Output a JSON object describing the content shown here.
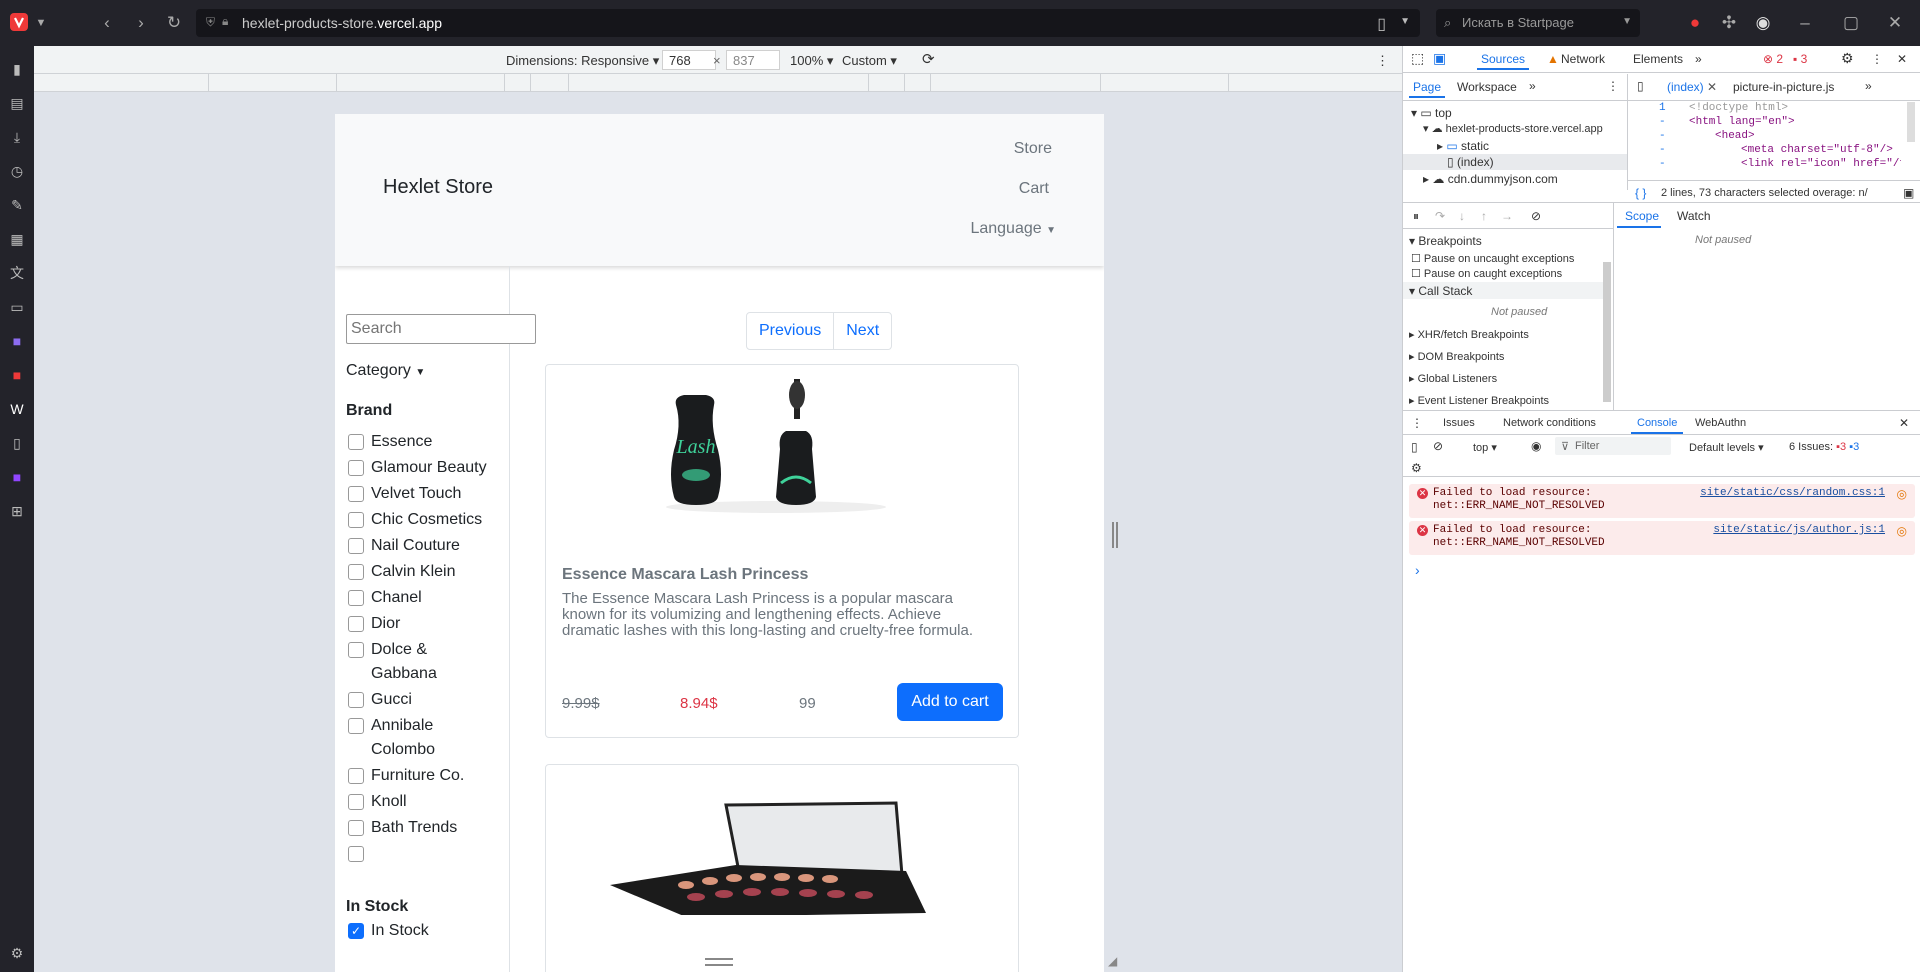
{
  "browser": {
    "url_host": "hexlet-products-store.",
    "url_domain": "vercel.app",
    "search_placeholder": "Искать в Startpage"
  },
  "device_toolbar": {
    "dimensions_label": "Dimensions: Responsive",
    "width_value": "768",
    "height_value": "837",
    "zoom_label": "100%",
    "throttle_label": "Custom",
    "times": "×"
  },
  "page": {
    "brand": "Hexlet Store",
    "nav": [
      "Store",
      "Cart",
      "Language"
    ],
    "search_placeholder": "Search",
    "category_label": "Category",
    "brand_section_title": "Brand",
    "brands": [
      "Essence",
      "Glamour Beauty",
      "Velvet Touch",
      "Chic Cosmetics",
      "Nail Couture",
      "Calvin Klein",
      "Chanel",
      "Dior",
      "Dolce & Gabbana",
      "Gucci",
      "Annibale Colombo",
      "Furniture Co.",
      "Knoll",
      "Bath Trends",
      ""
    ],
    "stock_section_title": "In Stock",
    "stock_label": "In Stock",
    "pager": {
      "previous": "Previous",
      "next": "Next"
    },
    "products": [
      {
        "title": "Essence Mascara Lash Princess",
        "description": "The Essence Mascara Lash Princess is a popular mascara known for its volumizing and lengthening effects. Achieve dramatic lashes with this long-lasting and cruelty-free formula.",
        "old_price": "9.99$",
        "new_price": "8.94$",
        "stock": "99",
        "add_label": "Add to cart"
      }
    ]
  },
  "devtools": {
    "top_tabs": [
      "Sources",
      "Network",
      "Elements"
    ],
    "error_count": "2",
    "warn_count": "3",
    "nav_tabs": [
      "Page",
      "Workspace"
    ],
    "file_tabs": [
      "(index)",
      "picture-in-picture.js"
    ],
    "tree": [
      "top",
      "hexlet-products-store.vercel.app",
      "static",
      "(index)",
      "cdn.dummyjson.com"
    ],
    "code_lines": [
      "<!doctype html>",
      "<html lang=\"en\">",
      "<head>",
      "<meta charset=\"utf-8\"/>",
      "<link rel=\"icon\" href=\"/f"
    ],
    "line_numbers": [
      "1",
      "-",
      "-",
      "-",
      "-"
    ],
    "selection_status": "2 lines, 73 characters selected  overage: n/",
    "scope_tabs": [
      "Scope",
      "Watch"
    ],
    "not_paused": "Not paused",
    "breakpoints_title": "Breakpoints",
    "pause_uncaught": "Pause on uncaught exceptions",
    "pause_caught": "Pause on caught exceptions",
    "call_stack_title": "Call Stack",
    "call_stack_status": "Not paused",
    "bp_sections": [
      "XHR/fetch Breakpoints",
      "DOM Breakpoints",
      "Global Listeners",
      "Event Listener Breakpoints"
    ],
    "drawer_tabs": [
      "Issues",
      "Network conditions",
      "Console",
      "WebAuthn"
    ],
    "console_context": "top",
    "filter_placeholder": "Filter",
    "levels": "Default levels",
    "issues_label": "6 Issues:",
    "issues_err": "3",
    "issues_info": "3",
    "errors": [
      {
        "text1": "Failed to load resource:",
        "text2": "net::ERR_NAME_NOT_RESOLVED",
        "link": "site/static/css/random.css:1"
      },
      {
        "text1": "Failed to load resource:",
        "text2": "net::ERR_NAME_NOT_RESOLVED",
        "link": "site/static/js/author.js:1"
      }
    ],
    "prompt": "›"
  },
  "colors": {
    "accent": "#0d6efd",
    "danger": "#dc3545",
    "devtools_blue": "#1a73e8"
  }
}
